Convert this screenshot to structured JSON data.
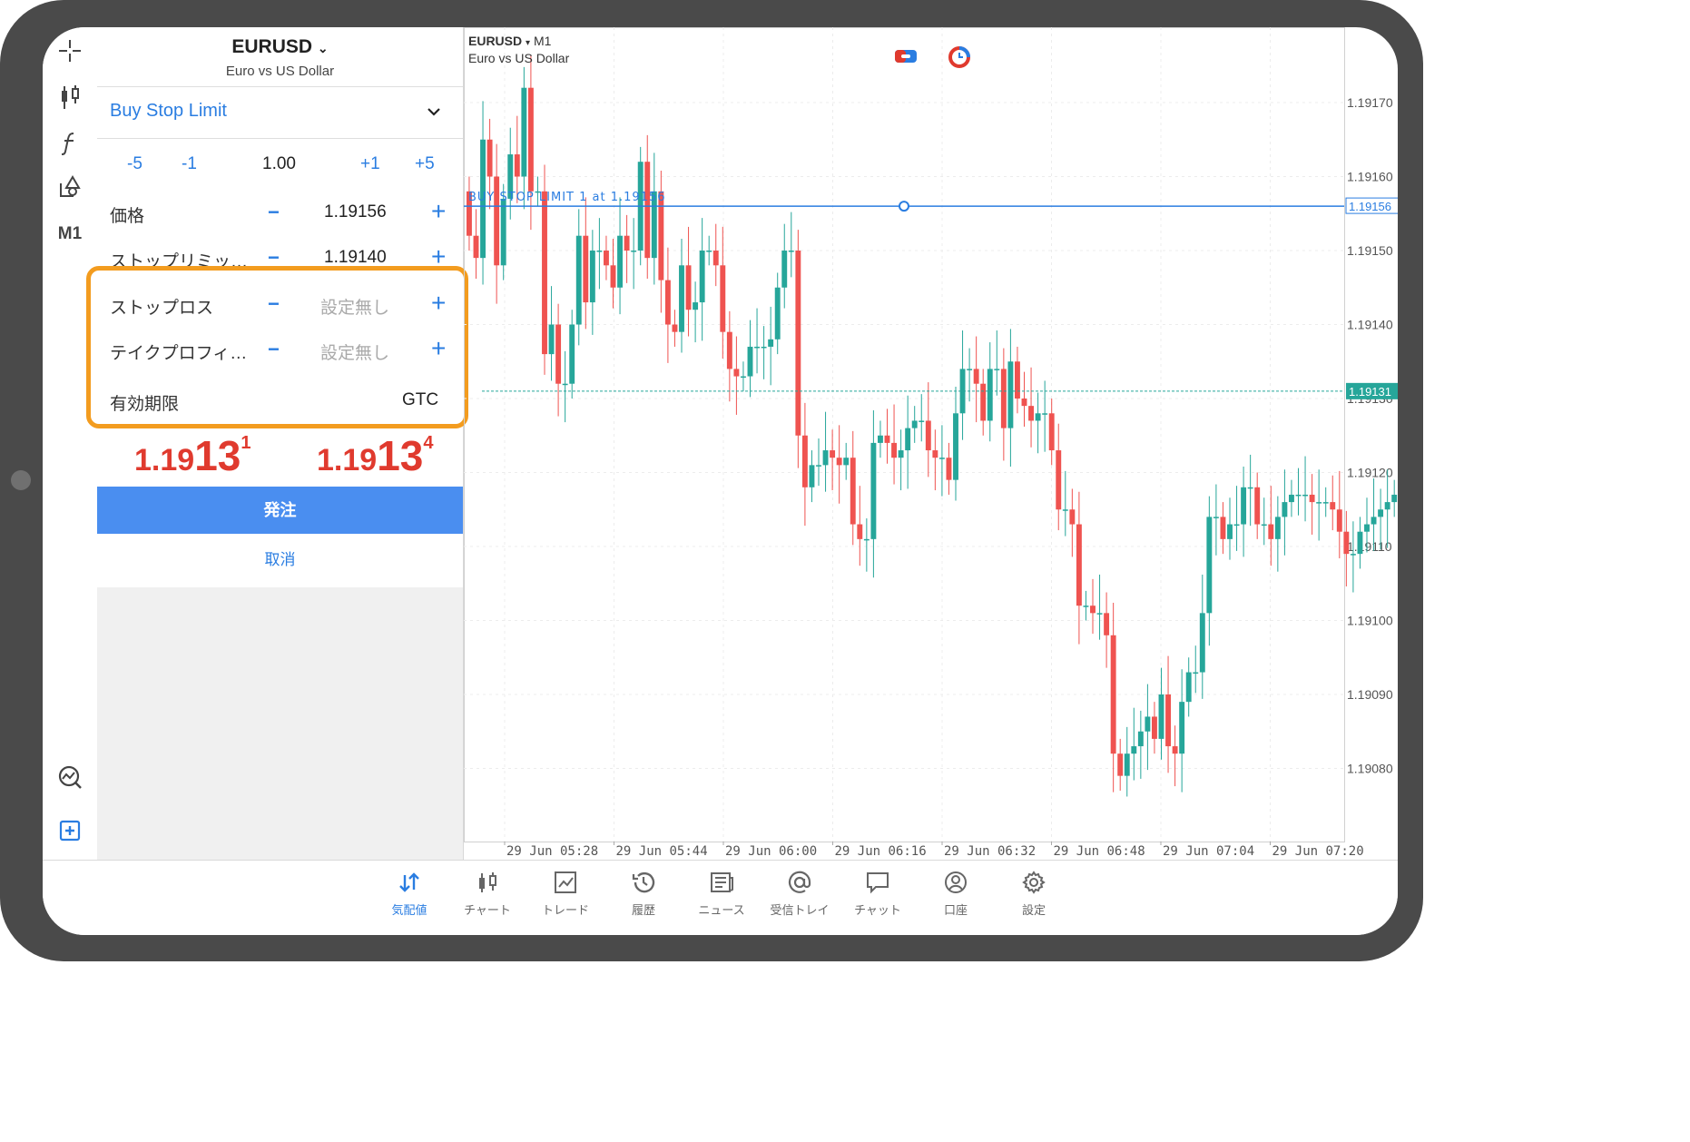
{
  "symbol": {
    "name": "EURUSD",
    "description": "Euro vs US Dollar"
  },
  "order_panel": {
    "order_type": "Buy Stop Limit",
    "volume": {
      "minus5": "-5",
      "minus1": "-1",
      "value": "1.00",
      "plus1": "+1",
      "plus5": "+5"
    },
    "rows": [
      {
        "label": "価格",
        "value": "1.19156"
      },
      {
        "label": "ストップリミッ…",
        "value": "1.19140"
      },
      {
        "label": "ストップロス",
        "value": "設定無し"
      },
      {
        "label": "テイクプロフィ…",
        "value": "設定無し"
      },
      {
        "label": "有効期限",
        "value": "GTC"
      }
    ],
    "minus_sign": "−",
    "plus_sign": "+",
    "bid": {
      "big1": "1.19",
      "big2": "13",
      "small": "1"
    },
    "ask": {
      "big1": "1.19",
      "big2": "13",
      "small": "4"
    },
    "submit_label": "発注",
    "cancel_label": "取消"
  },
  "toolbar": {
    "timeframe": "M1",
    "icons": [
      "crosshair-icon",
      "candlestick-icon",
      "function-icon",
      "objects-icon",
      "timeframe",
      "signals-icon",
      "new-order-icon"
    ]
  },
  "chart": {
    "symbol": "EURUSD",
    "arrow": "▾",
    "timeframe": "M1",
    "description": "Euro vs US Dollar",
    "order_line_label": "BUY STOP LIMIT 1 at 1.19156",
    "order_line_price": "1.19156",
    "current_price": "1.19131",
    "price_ticks": [
      "1.19170",
      "1.19160",
      "1.19150",
      "1.19140",
      "1.19130",
      "1.19120",
      "1.19110",
      "1.19100",
      "1.19090",
      "1.19080"
    ],
    "time_ticks": [
      "29 Jun 05:28",
      "29 Jun 05:44",
      "29 Jun 06:00",
      "29 Jun 06:16",
      "29 Jun 06:32",
      "29 Jun 06:48",
      "29 Jun 07:04",
      "29 Jun 07:20"
    ],
    "colors": {
      "up": "#26a69a",
      "down": "#ef5350",
      "order_line": "#2a7de1",
      "bid_line": "#26a69a"
    }
  },
  "bottom_nav": [
    {
      "label": "気配値",
      "icon": "quotes-icon",
      "active": true
    },
    {
      "label": "チャート",
      "icon": "chart-icon",
      "active": false
    },
    {
      "label": "トレード",
      "icon": "trade-icon",
      "active": false
    },
    {
      "label": "履歴",
      "icon": "history-icon",
      "active": false
    },
    {
      "label": "ニュース",
      "icon": "news-icon",
      "active": false
    },
    {
      "label": "受信トレイ",
      "icon": "mailbox-icon",
      "active": false
    },
    {
      "label": "チャット",
      "icon": "chat-icon",
      "active": false
    },
    {
      "label": "口座",
      "icon": "account-icon",
      "active": false
    },
    {
      "label": "設定",
      "icon": "settings-icon",
      "active": false
    }
  ],
  "highlight_color": "#f39c1f"
}
